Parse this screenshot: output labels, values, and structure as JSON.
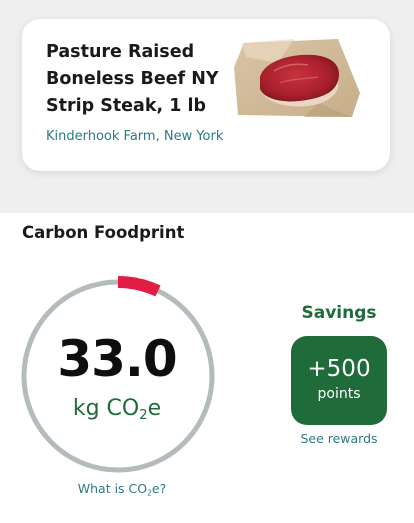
{
  "product": {
    "name": "Pasture Raised Boneless Beef NY Strip Steak, 1 lb",
    "origin": "Kinderhook Farm, New York",
    "image_icon": "steak-photo"
  },
  "footprint": {
    "title": "Carbon Foodprint",
    "value": "33.0",
    "unit_prefix": "kg CO",
    "unit_sub": "2",
    "unit_suffix": "e",
    "gauge_level": 0.07,
    "gauge_track_color": "#b3bcb8",
    "gauge_fill_color": "#e31c45",
    "info_link_prefix": "What is CO",
    "info_link_sub": "2",
    "info_link_suffix": "e?"
  },
  "savings": {
    "title": "Savings",
    "points_amount": "+500",
    "points_label": "points",
    "rewards_link": "See rewards",
    "accent_color": "#1f6b3a"
  }
}
